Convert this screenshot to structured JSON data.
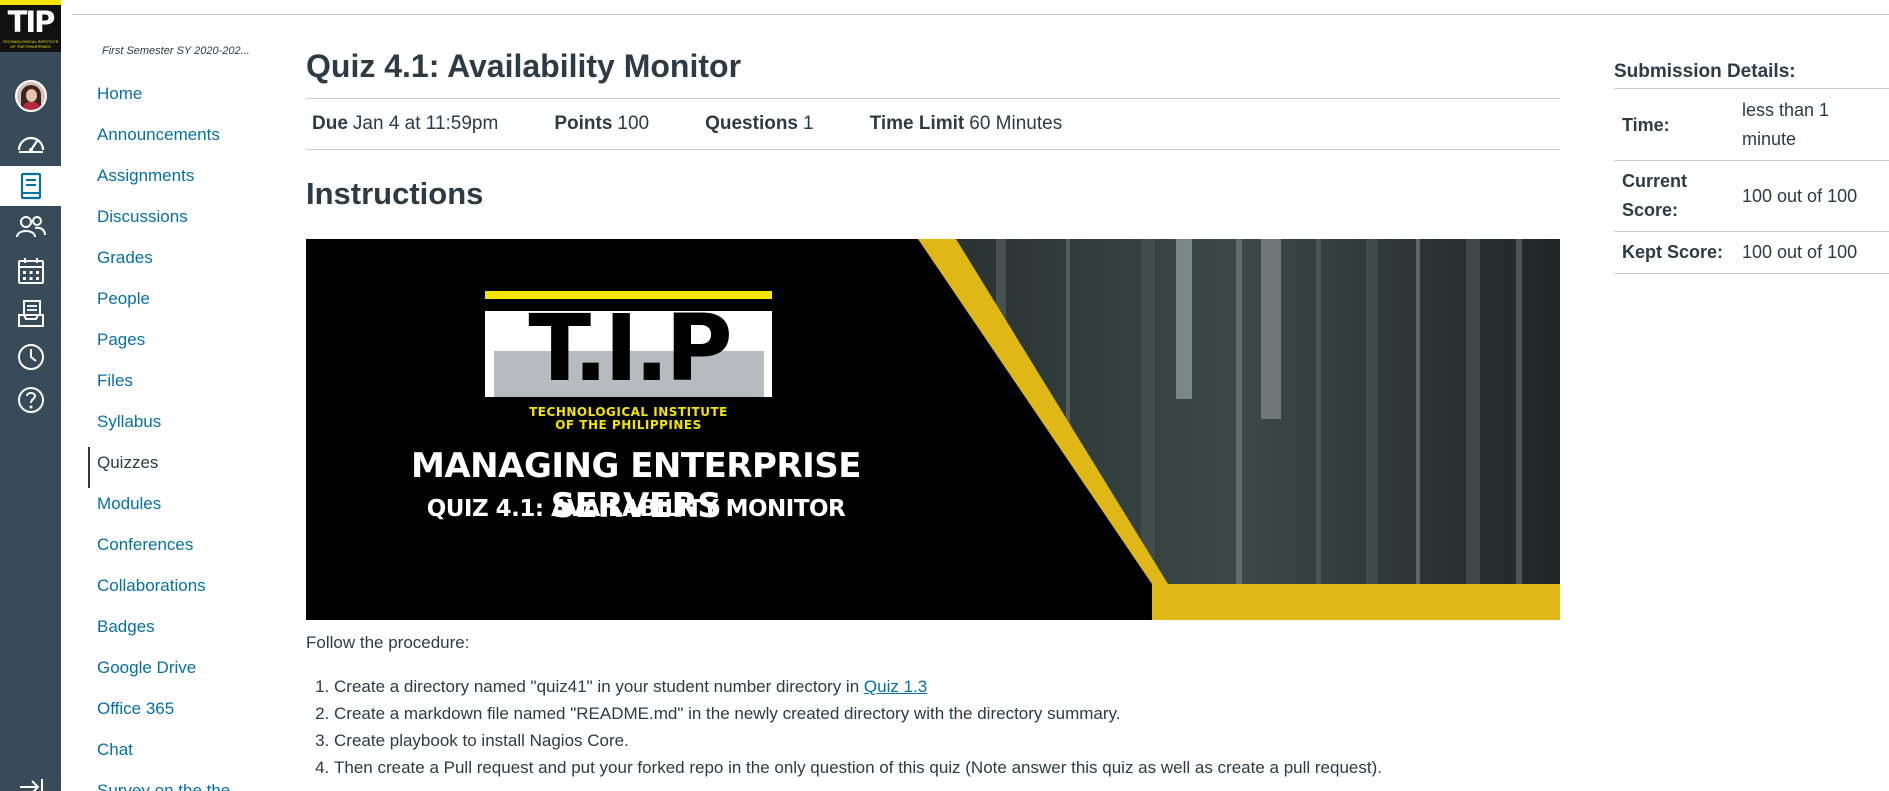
{
  "global_nav": {
    "logo_text": "TIP",
    "logo_subtext": "TECHNOLOGICAL INSTITUTE OF THE PHILIPPINES",
    "items": [
      {
        "icon": "account-avatar-icon"
      },
      {
        "icon": "dashboard-icon"
      },
      {
        "icon": "courses-icon",
        "active": true
      },
      {
        "icon": "groups-icon"
      },
      {
        "icon": "calendar-icon"
      },
      {
        "icon": "inbox-icon"
      },
      {
        "icon": "history-icon"
      },
      {
        "icon": "help-icon"
      },
      {
        "icon": "collapse-nav-icon"
      }
    ]
  },
  "course_nav": {
    "term": "First Semester SY 2020-202...",
    "items": [
      {
        "label": "Home"
      },
      {
        "label": "Announcements"
      },
      {
        "label": "Assignments"
      },
      {
        "label": "Discussions"
      },
      {
        "label": "Grades"
      },
      {
        "label": "People"
      },
      {
        "label": "Pages"
      },
      {
        "label": "Files"
      },
      {
        "label": "Syllabus"
      },
      {
        "label": "Quizzes",
        "active": true
      },
      {
        "label": "Modules"
      },
      {
        "label": "Conferences"
      },
      {
        "label": "Collaborations"
      },
      {
        "label": "Badges"
      },
      {
        "label": "Google Drive"
      },
      {
        "label": "Office 365"
      },
      {
        "label": "Chat"
      },
      {
        "label": "Survey on the the"
      }
    ]
  },
  "quiz": {
    "title": "Quiz 4.1: Availability Monitor",
    "meta": {
      "due_label": "Due",
      "due_value": "Jan 4 at 11:59pm",
      "points_label": "Points",
      "points_value": "100",
      "questions_label": "Questions",
      "questions_value": "1",
      "time_limit_label": "Time Limit",
      "time_limit_value": "60 Minutes"
    },
    "instructions_heading": "Instructions",
    "banner": {
      "logo_letters": "T.I.P",
      "logo_sub1": "TECHNOLOGICAL INSTITUTE",
      "logo_sub2": "OF THE PHILIPPINES",
      "title": "MANAGING ENTERPRISE SERVERS",
      "subtitle": "QUIZ 4.1: AVAILABILITY MONITOR",
      "accent_color": "#dfb817"
    },
    "procedure_intro": "Follow the procedure:",
    "steps": [
      {
        "text": "Create a directory named \"quiz41\" in your student number directory in ",
        "link": "Quiz 1.3"
      },
      {
        "text": "Create a markdown file named \"README.md\" in the newly created directory with the directory summary."
      },
      {
        "text": "Create playbook to install Nagios Core."
      },
      {
        "text": "Then create a Pull request and put your forked repo in the only question of this quiz (Note answer this quiz as well as create a pull request)."
      }
    ]
  },
  "submission_details": {
    "heading": "Submission Details:",
    "rows": [
      {
        "label": "Time:",
        "value": "less than 1 minute"
      },
      {
        "label": "Current Score:",
        "value": "100 out of 100"
      },
      {
        "label": "Kept Score:",
        "value": "100 out of 100"
      }
    ]
  },
  "colors": {
    "global_nav_bg": "#394b58",
    "link": "#0770a3",
    "text": "#2d3b45"
  }
}
